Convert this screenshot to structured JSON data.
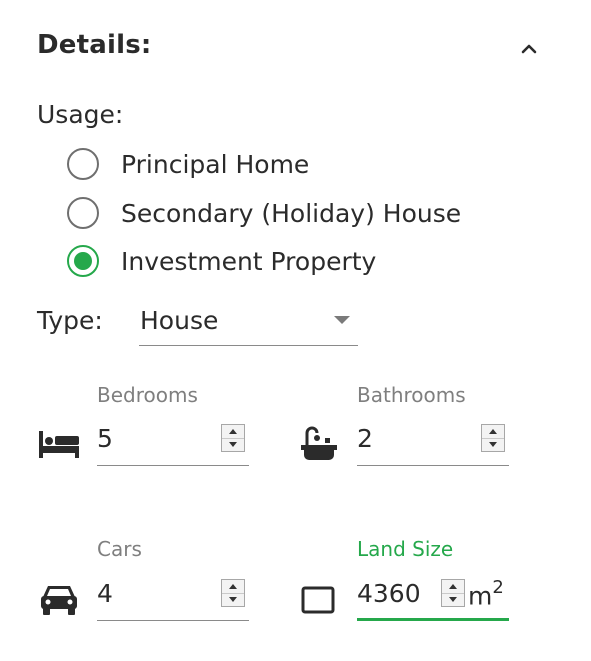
{
  "details": {
    "title": "Details:",
    "collapse_icon": "chevron-up-icon"
  },
  "usage": {
    "label": "Usage:",
    "options": [
      {
        "label": "Principal Home",
        "checked": false
      },
      {
        "label": "Secondary (Holiday) House",
        "checked": false
      },
      {
        "label": "Investment Property",
        "checked": true
      }
    ]
  },
  "type": {
    "label": "Type:",
    "value": "House"
  },
  "fields": {
    "bedrooms": {
      "label": "Bedrooms",
      "value": "5",
      "icon": "bed-icon"
    },
    "bathrooms": {
      "label": "Bathrooms",
      "value": "2",
      "icon": "bathtub-icon"
    },
    "cars": {
      "label": "Cars",
      "value": "4",
      "icon": "car-icon"
    },
    "land_size": {
      "label": "Land Size",
      "value": "4360",
      "unit": "m",
      "unit_exp": "2",
      "icon": "area-square-icon"
    }
  },
  "colors": {
    "accent": "#25a84b",
    "text": "#2b2b2b",
    "muted": "#7f7f7f"
  }
}
